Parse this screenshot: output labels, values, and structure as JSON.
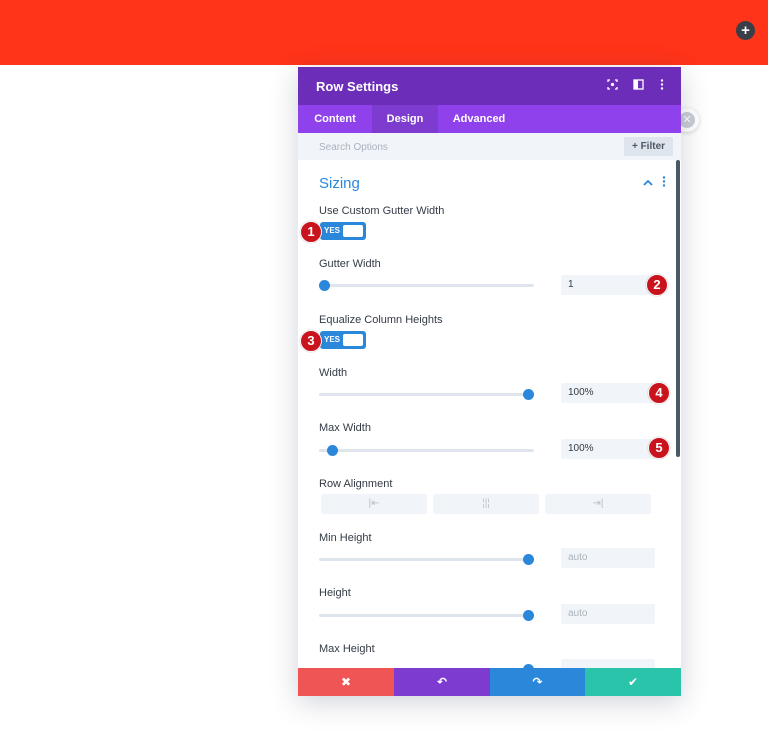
{
  "colors": {
    "topbar": "#ff3419",
    "header": "#6c2eb9",
    "tabs": "#8f42ec",
    "accent": "#2b87da",
    "cancel": "#ef5555",
    "undo": "#7d3bcf",
    "redo": "#2b87da",
    "save": "#29c4a9",
    "badge": "#c9141e"
  },
  "topbar": {
    "add_icon": "plus-icon",
    "add_label": "+"
  },
  "modal": {
    "title": "Row Settings",
    "header_icons": [
      "focus-icon",
      "split-icon",
      "more-icon"
    ],
    "tabs": [
      {
        "label": "Content"
      },
      {
        "label": "Design",
        "active": true
      },
      {
        "label": "Advanced"
      }
    ],
    "search": {
      "placeholder": "Search Options",
      "filter_label": "Filter",
      "filter_icon": "plus-icon"
    },
    "section": {
      "title": "Sizing",
      "collapse_icon": "chevron-up-icon",
      "more_icon": "more-icon"
    },
    "fields": {
      "custom_gutter": {
        "label": "Use Custom Gutter Width",
        "toggle": "YES"
      },
      "gutter_width": {
        "label": "Gutter Width",
        "value": "1",
        "slider_fraction": 0.0
      },
      "equalize": {
        "label": "Equalize Column Heights",
        "toggle": "YES"
      },
      "width": {
        "label": "Width",
        "value": "100%",
        "slider_fraction": 1.0
      },
      "max_width": {
        "label": "Max Width",
        "value": "100%",
        "slider_fraction": 0.04
      },
      "row_alignment": {
        "label": "Row Alignment",
        "options": [
          "align-left-icon",
          "align-center-icon",
          "align-right-icon"
        ]
      },
      "min_height": {
        "label": "Min Height",
        "value": "auto",
        "slider_fraction": 1.0
      },
      "height": {
        "label": "Height",
        "value": "auto",
        "slider_fraction": 1.0
      },
      "max_height": {
        "label": "Max Height"
      }
    },
    "badges": [
      "1",
      "2",
      "3",
      "4",
      "5"
    ],
    "footer": {
      "cancel": "✖",
      "undo": "↶",
      "redo": "↷",
      "save": "✔"
    }
  }
}
